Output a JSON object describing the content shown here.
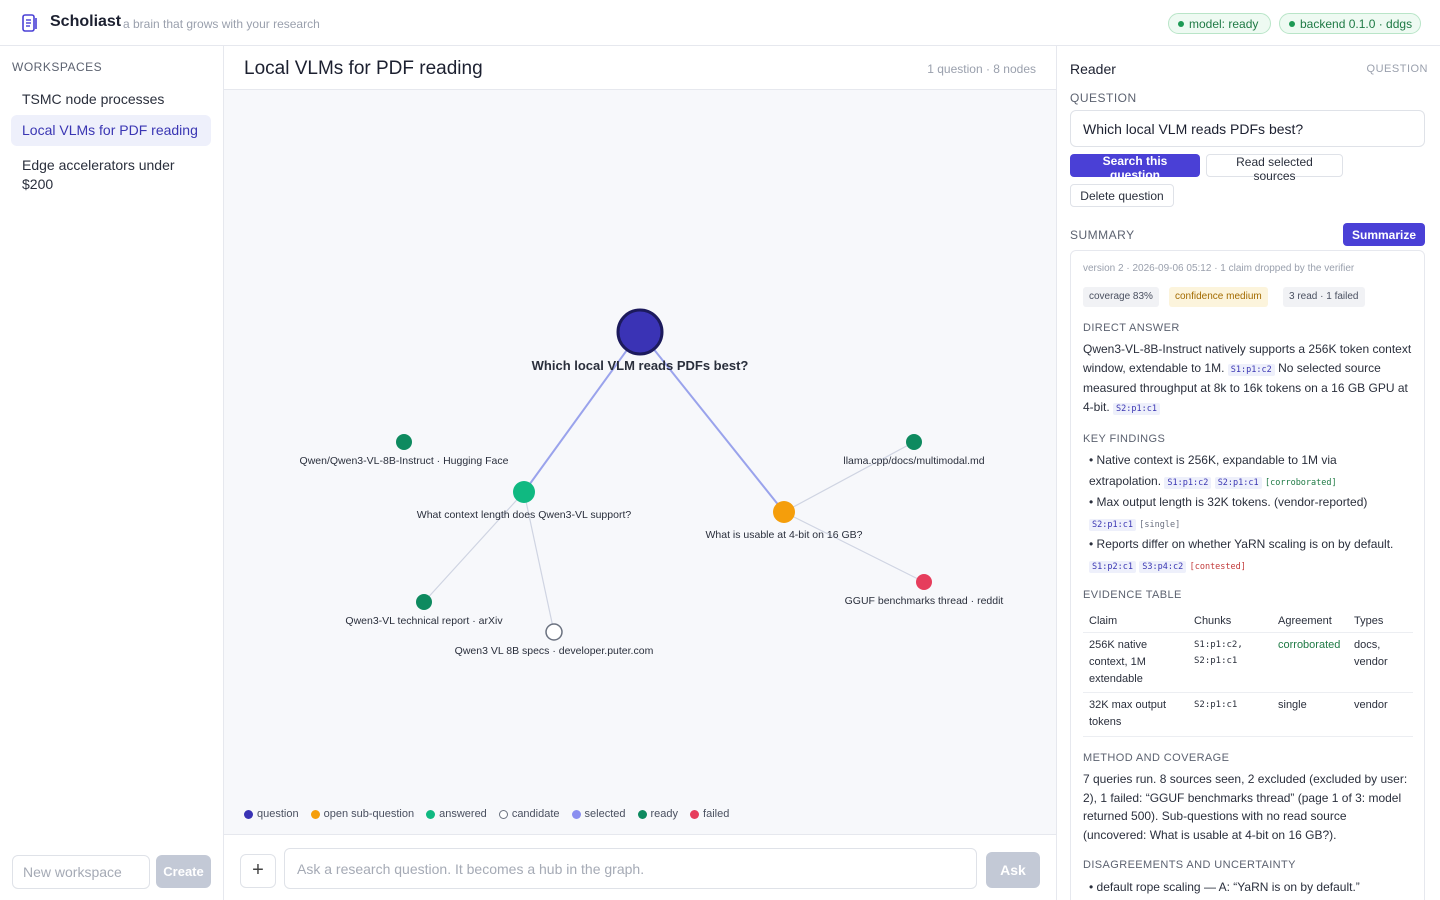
{
  "app": {
    "name": "Scholiast",
    "tagline": "a brain that grows with your research",
    "status_model": "model: ready",
    "status_backend": "backend 0.1.0 · ddgs",
    "colors": {
      "accent": "#4a40d6",
      "ready": "#1e9a55"
    }
  },
  "sidebar": {
    "heading": "WORKSPACES",
    "items": [
      {
        "label": "TSMC node processes",
        "active": false
      },
      {
        "label": "Local VLMs for PDF reading",
        "active": true
      },
      {
        "label": "Edge accelerators under $200",
        "active": false
      }
    ],
    "new_placeholder": "New workspace",
    "create_label": "Create"
  },
  "center": {
    "title": "Local VLMs for PDF reading",
    "meta": "1 question · 8 nodes",
    "graph": {
      "nodes": [
        {
          "id": "q",
          "label": "Which local VLM reads PDFs best?",
          "kind": "question"
        },
        {
          "id": "s1",
          "label": "What context length does Qwen3-VL support?",
          "kind": "answered"
        },
        {
          "id": "s2",
          "label": "What is usable at 4-bit on 16 GB?",
          "kind": "open"
        },
        {
          "id": "src1",
          "label": "Qwen/Qwen3-VL-8B-Instruct · Hugging Face",
          "kind": "ready"
        },
        {
          "id": "src2",
          "label": "Qwen3-VL technical report · arXiv",
          "kind": "ready"
        },
        {
          "id": "src3",
          "label": "Qwen3 VL 8B specs · developer.puter.com",
          "kind": "candidate"
        },
        {
          "id": "src4",
          "label": "llama.cpp/docs/multimodal.md",
          "kind": "ready"
        },
        {
          "id": "src5",
          "label": "GGUF benchmarks thread · reddit",
          "kind": "failed"
        }
      ],
      "edges": [
        [
          "q",
          "s1"
        ],
        [
          "q",
          "s2"
        ],
        [
          "s1",
          "src2"
        ],
        [
          "s1",
          "src3"
        ],
        [
          "s2",
          "src4"
        ],
        [
          "s2",
          "src5"
        ]
      ]
    },
    "legend": [
      {
        "label": "question",
        "color": "#3a33b5",
        "hollow": false
      },
      {
        "label": "open sub-question",
        "color": "#f59e0b",
        "hollow": false
      },
      {
        "label": "answered",
        "color": "#10b981",
        "hollow": false
      },
      {
        "label": "candidate",
        "color": "#6b7280",
        "hollow": true
      },
      {
        "label": "selected",
        "color": "#8b8ff0",
        "hollow": false
      },
      {
        "label": "ready",
        "color": "#0e8a5f",
        "hollow": false
      },
      {
        "label": "failed",
        "color": "#e63d5c",
        "hollow": false
      }
    ],
    "composer": {
      "plus_label": "+",
      "placeholder": "Ask a research question. It becomes a hub in the graph.",
      "ask_label": "Ask"
    }
  },
  "reader": {
    "title": "Reader",
    "mode": "QUESTION",
    "question_label": "QUESTION",
    "question_text": "Which local VLM reads PDFs best?",
    "btn_search": "Search this question",
    "btn_read": "Read selected sources",
    "btn_delete": "Delete question",
    "summary_label": "SUMMARY",
    "btn_summarize": "Summarize",
    "summary": {
      "meta": "version 2 · 2026-09-06 05:12 · 1 claim dropped by the verifier",
      "chip_coverage": "coverage 83%",
      "chip_confidence": "confidence medium",
      "chip_read": "3 read · 1 failed",
      "direct_label": "DIRECT ANSWER",
      "direct_1": "Qwen3-VL-8B-Instruct natively supports a 256K token context window, extendable to 1M.",
      "direct_cite_1": "S1:p1:c2",
      "direct_2": "No selected source measured throughput at 8k to 16k tokens on a 16 GB GPU at 4-bit.",
      "direct_cite_2": "S2:p1:c1",
      "findings_label": "KEY FINDINGS",
      "findings": [
        {
          "text": "Native context is 256K, expandable to 1M via extrapolation.",
          "cites": [
            "S1:p1:c2",
            "S2:p1:c1"
          ],
          "tag": "[corroborated]"
        },
        {
          "text": "Max output length is 32K tokens. (vendor-reported)",
          "cites": [
            "S2:p1:c1"
          ],
          "tag": "[single]"
        },
        {
          "text": "Reports differ on whether YaRN scaling is on by default.",
          "cites": [
            "S1:p2:c1",
            "S3:p4:c2"
          ],
          "tag": "[contested]"
        }
      ],
      "evidence_label": "EVIDENCE TABLE",
      "evidence_headers": [
        "Claim",
        "Chunks",
        "Agreement",
        "Types"
      ],
      "evidence_rows": [
        {
          "claim": "256K native context, 1M extendable",
          "chunks_1": "S1:p1:c2,",
          "chunks_2": "S2:p1:c1",
          "agreement": "corroborated",
          "types": "docs, vendor"
        },
        {
          "claim": "32K max output tokens",
          "chunks_1": "S2:p1:c1",
          "chunks_2": "",
          "agreement": "single",
          "types": "vendor"
        }
      ],
      "method_label": "METHOD AND COVERAGE",
      "method_text": "7 queries run. 8 sources seen, 2 excluded (excluded by user: 2), 1 failed: “GGUF benchmarks thread” (page 1 of 3: model returned 500). Sub-questions with no read source (uncovered: What is usable at 4-bit on 16 GB?).",
      "disagree_label": "DISAGREEMENTS AND UNCERTAINTY",
      "disagree_text": "• default rope scaling — A: “YaRN is on by default.”"
    }
  }
}
